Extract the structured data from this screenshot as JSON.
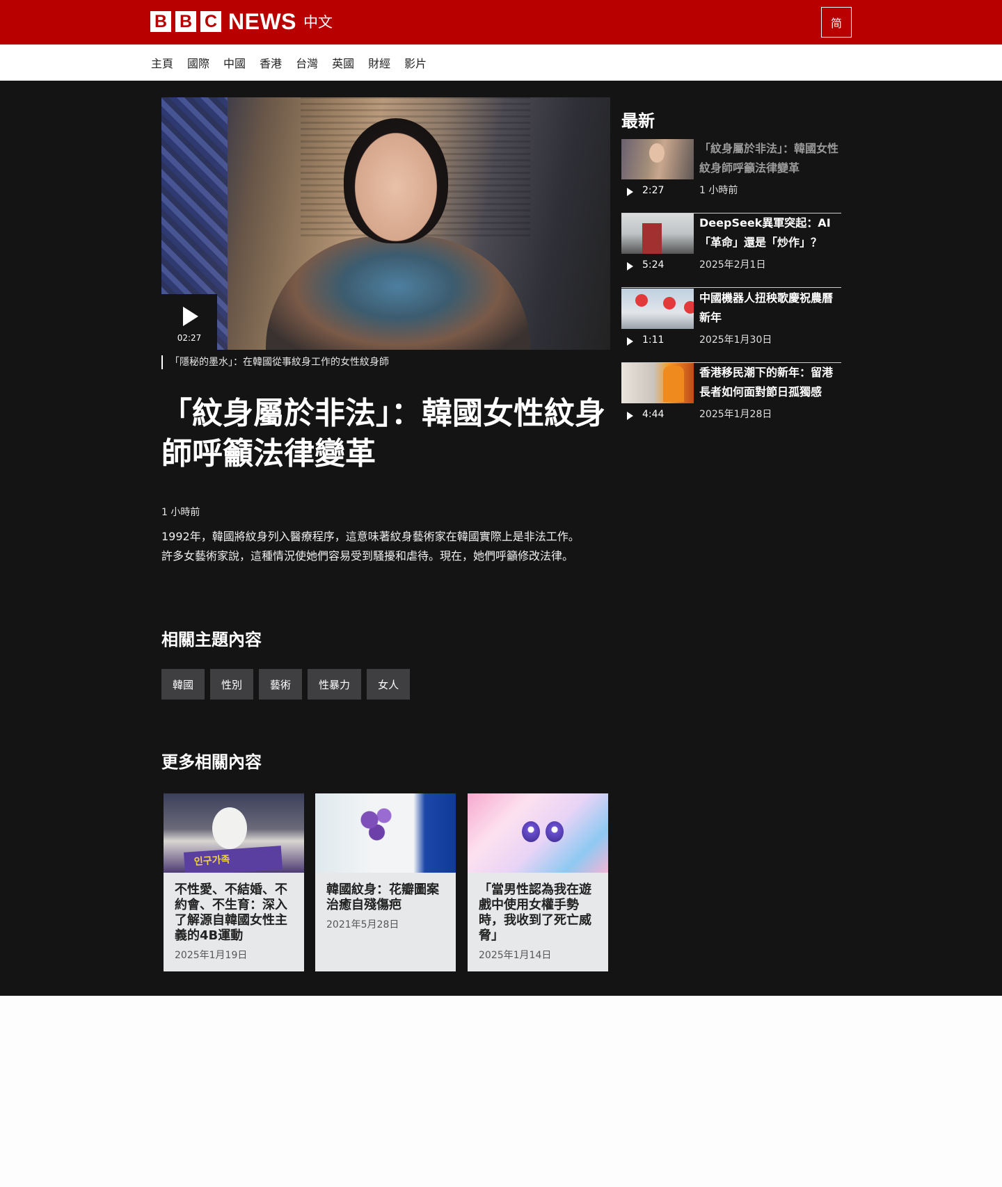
{
  "header": {
    "logo_news": "NEWS",
    "logo_zh": "中文",
    "lang_toggle": "简",
    "brand_color": "#b80000"
  },
  "nav": {
    "items": [
      "主頁",
      "國際",
      "中國",
      "香港",
      "台灣",
      "英國",
      "財經",
      "影片"
    ]
  },
  "video": {
    "duration": "02:27",
    "caption": "「隱秘的墨水」：在韓國從事紋身工作的女性紋身師"
  },
  "article": {
    "headline": "「紋身屬於非法」：韓國女性紋身師呼籲法律變革",
    "timestamp": "1 小時前",
    "summary_line1": "1992年，韓國將紋身列入醫療程序，這意味著紋身藝術家在韓國實際上是非法工作。",
    "summary_line2": "許多女藝術家說，這種情況使她們容易受到騷擾和虐待。現在，她們呼籲修改法律。"
  },
  "topics": {
    "title": "相關主題內容",
    "tags": [
      "韓國",
      "性別",
      "藝術",
      "性暴力",
      "女人"
    ]
  },
  "more": {
    "title": "更多相關內容",
    "cards": [
      {
        "title": "不性愛、不結婚、不約會、不生育：深入了解源自韓國女性主義的4B運動",
        "date": "2025年1月19日",
        "thumb_text": "인구가족"
      },
      {
        "title": "韓國紋身：花瓣圖案治癒自殘傷疤",
        "date": "2021年5月28日"
      },
      {
        "title": "「當男性認為我在遊戲中使用女權手勢時，我收到了死亡威脅」",
        "date": "2025年1月14日"
      }
    ]
  },
  "sidebar": {
    "title": "最新",
    "items": [
      {
        "headline": "「紋身屬於非法」：韓國女性紋身師呼籲法律變革",
        "duration": "2:27",
        "date": "1 小時前",
        "visited": true
      },
      {
        "headline": "DeepSeek異軍突起：AI「革命」還是「炒作」？",
        "duration": "5:24",
        "date": "2025年2月1日",
        "visited": false
      },
      {
        "headline": "中國機器人扭秧歌慶祝農曆新年",
        "duration": "1:11",
        "date": "2025年1月30日",
        "visited": false
      },
      {
        "headline": "香港移民潮下的新年：留港長者如何面對節日孤獨感",
        "duration": "4:44",
        "date": "2025年1月28日",
        "visited": false
      }
    ]
  }
}
